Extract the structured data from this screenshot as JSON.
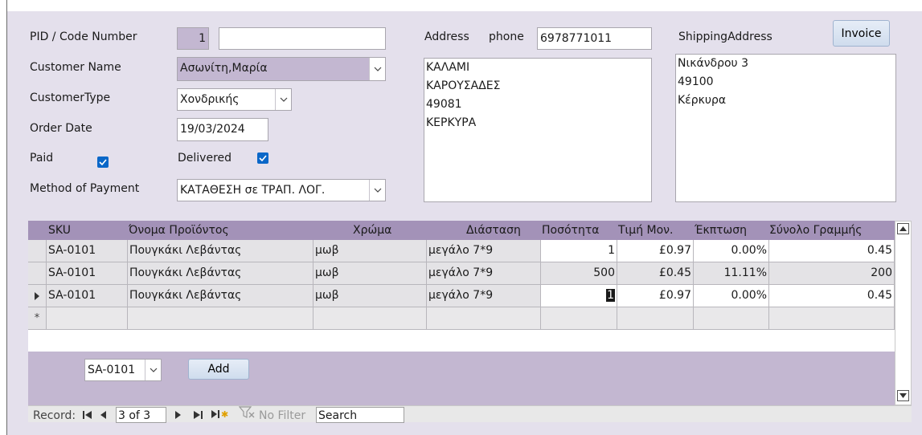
{
  "form": {
    "pid_label": "PID / Code Number",
    "pid_value": "1",
    "customer_name_label": "Customer Name",
    "customer_name_value": "Ασωνίτη,Μαρία",
    "customer_type_label": "CustomerType",
    "customer_type_value": "Χονδρικής",
    "order_date_label": "Order Date",
    "order_date_value": "19/03/2024",
    "paid_label": "Paid",
    "delivered_label": "Delivered",
    "payment_label": "Method of Payment",
    "payment_value": "ΚΑΤΑΘΕΣΗ σε ΤΡΑΠ. ΛΟΓ.",
    "address_label": "Address",
    "phone_label": "phone",
    "phone_value": "6978771011",
    "address_value": "ΚΑΛΑΜΙ\nΚΑΡΟΥΣΑΔΕΣ\n49081\nΚΕΡΚΥΡΑ",
    "shipping_label": "ShippingAddress",
    "shipping_value": "Νικάνδρου 3\n49100\nΚέρκυρα",
    "invoice_button": "Invoice"
  },
  "grid": {
    "headers": [
      "SKU",
      "Όνομα Προϊόντος",
      "Χρώμα",
      "Διάσταση",
      "Ποσότητα",
      "Τιμή Μον.",
      "Έκπτωση",
      "Σύνολο Γραμμής"
    ],
    "rows": [
      {
        "sku": "SA-0101",
        "name": "Πουγκάκι Λεβάντας",
        "color": "μωβ",
        "size": "μεγάλο 7*9",
        "qty": "1",
        "price": "£0.97",
        "discount": "0.00%",
        "total": "0.45"
      },
      {
        "sku": "SA-0101",
        "name": "Πουγκάκι Λεβάντας",
        "color": "μωβ",
        "size": "μεγάλο 7*9",
        "qty": "500",
        "price": "£0.45",
        "discount": "11.11%",
        "total": "200"
      },
      {
        "sku": "SA-0101",
        "name": "Πουγκάκι Λεβάντας",
        "color": "μωβ",
        "size": "μεγάλο 7*9",
        "qty": "1",
        "price": "£0.97",
        "discount": "0.00%",
        "total": "0.45"
      }
    ],
    "new_row_marker": "*",
    "sku_select_value": "SA-0101",
    "add_button": "Add"
  },
  "navigation": {
    "record_label": "Record:",
    "record_position": "3 of 3",
    "no_filter": "No Filter",
    "search_placeholder": "Search"
  },
  "colors": {
    "form_background": "#e4e0ec",
    "header_background": "#a392b8",
    "customer_field": "#c3b7d1",
    "checkbox": "#0a67c8"
  }
}
